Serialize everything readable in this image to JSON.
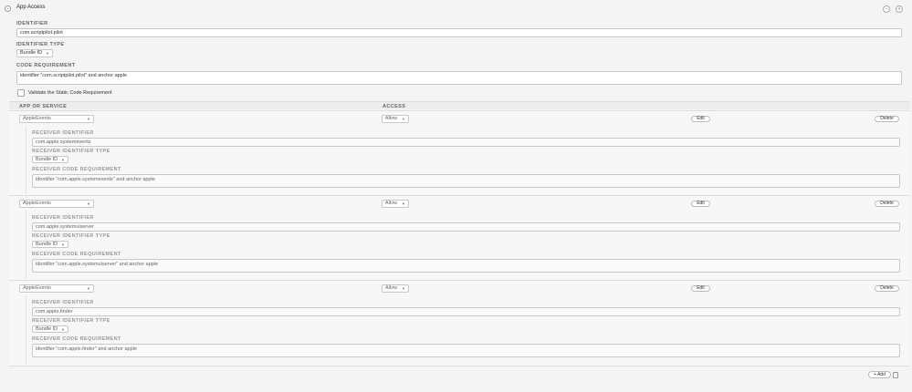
{
  "header": {
    "title": "App Access",
    "collapse_icon": "chevron-down-icon"
  },
  "identifier": {
    "label": "IDENTIFIER",
    "value": "com.scriptpilot.pilot"
  },
  "identifier_type": {
    "label": "IDENTIFIER TYPE",
    "value": "Bundle ID"
  },
  "code_requirement": {
    "label": "CODE REQUIREMENT",
    "value": "identifier \"com.scriptpilot.pilot\" and anchor apple"
  },
  "validate": {
    "label": "Validate the Static Code Requirement",
    "checked": false
  },
  "table": {
    "col_app": "APP OR SERVICE",
    "col_access": "ACCESS",
    "edit_label": "Edit",
    "delete_label": "Delete",
    "receiver_identifier_label": "RECEIVER IDENTIFIER",
    "receiver_identifier_type_label": "RECEIVER IDENTIFIER TYPE",
    "receiver_code_requirement_label": "RECEIVER CODE REQUIREMENT",
    "rows": [
      {
        "app": "AppleEvents",
        "access": "Allow",
        "receiver_identifier": "com.apple.systemevents",
        "receiver_identifier_type": "Bundle ID",
        "receiver_code_requirement": "identifier \"com.apple.systemevents\" and anchor apple"
      },
      {
        "app": "AppleEvents",
        "access": "Allow",
        "receiver_identifier": "com.apple.systemuiserver",
        "receiver_identifier_type": "Bundle ID",
        "receiver_code_requirement": "identifier \"com.apple.systemuiserver\" and anchor apple"
      },
      {
        "app": "AppleEvents",
        "access": "Allow",
        "receiver_identifier": "com.apple.finder",
        "receiver_identifier_type": "Bundle ID",
        "receiver_code_requirement": "identifier \"com.apple.finder\" and anchor apple"
      }
    ]
  },
  "footer": {
    "add_label": "Add",
    "add_icon": "plus-icon",
    "trash_icon": "trash-icon"
  }
}
